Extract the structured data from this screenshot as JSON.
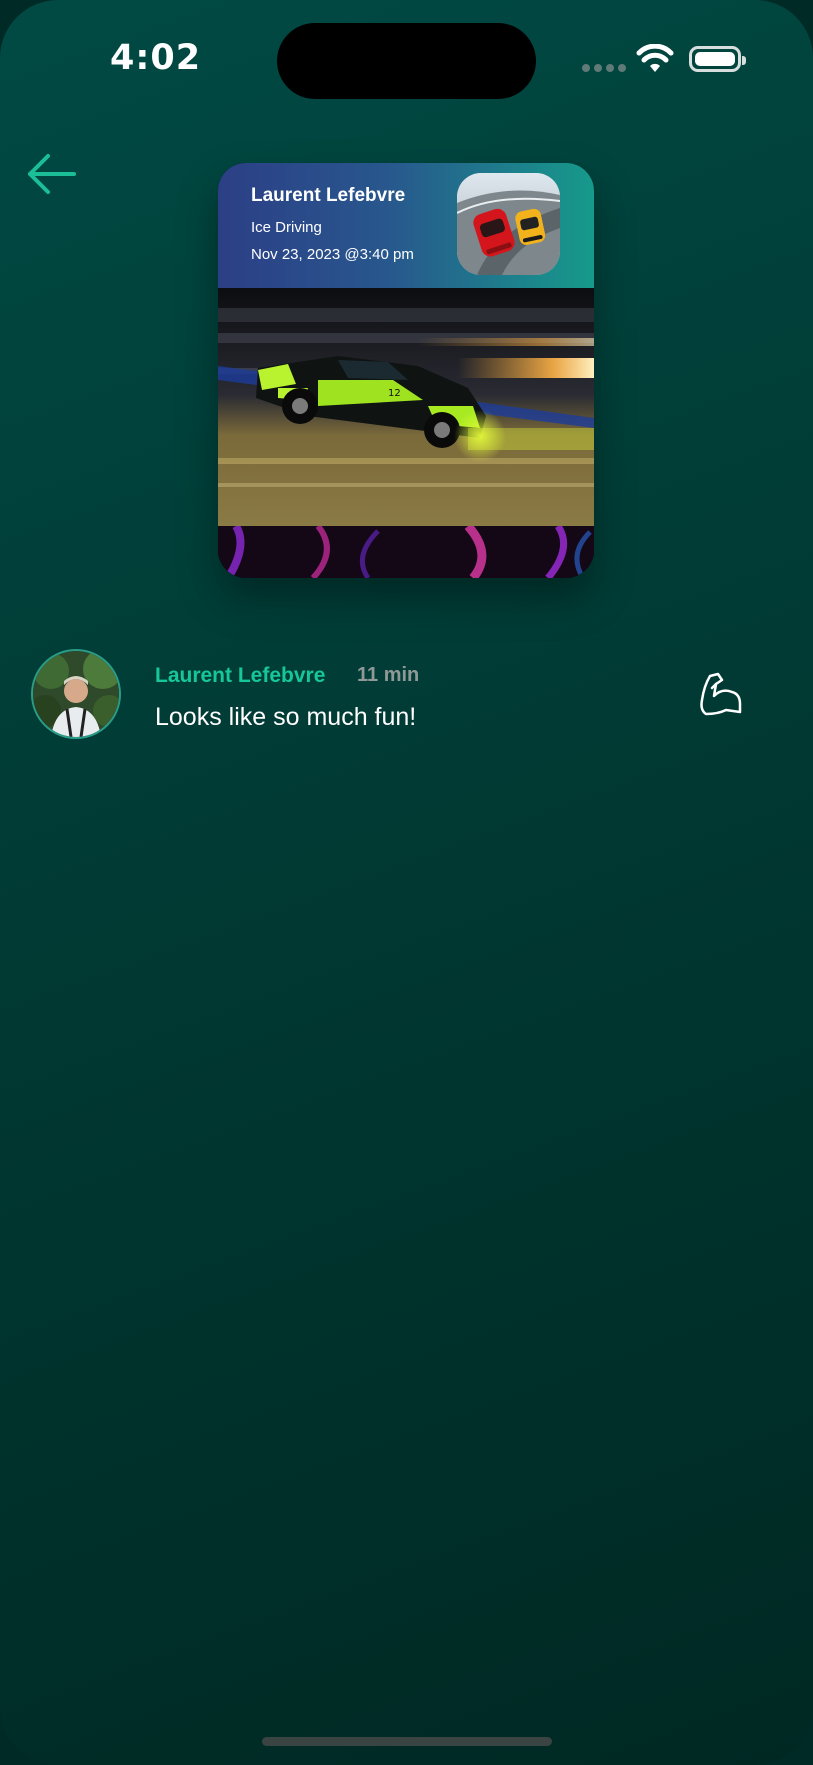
{
  "status_bar": {
    "time": "4:02"
  },
  "nav": {
    "back_icon": "arrow-left-icon"
  },
  "post_card": {
    "author": "Laurent Lefebvre",
    "activity": "Ice Driving",
    "date": "Nov 23, 2023 @3:40 pm",
    "app_icon": "racing-game-app-icon",
    "photo": "race-car-photo",
    "header_gradient": [
      "#2c3f86",
      "#169a8b"
    ]
  },
  "comment": {
    "author": "Laurent Lefebvre",
    "time": "11 min",
    "text": "Looks like so much fun!",
    "reaction_icon": "flexed-bicep-icon"
  },
  "colors": {
    "accent": "#16c79a",
    "background": "#013a34"
  }
}
